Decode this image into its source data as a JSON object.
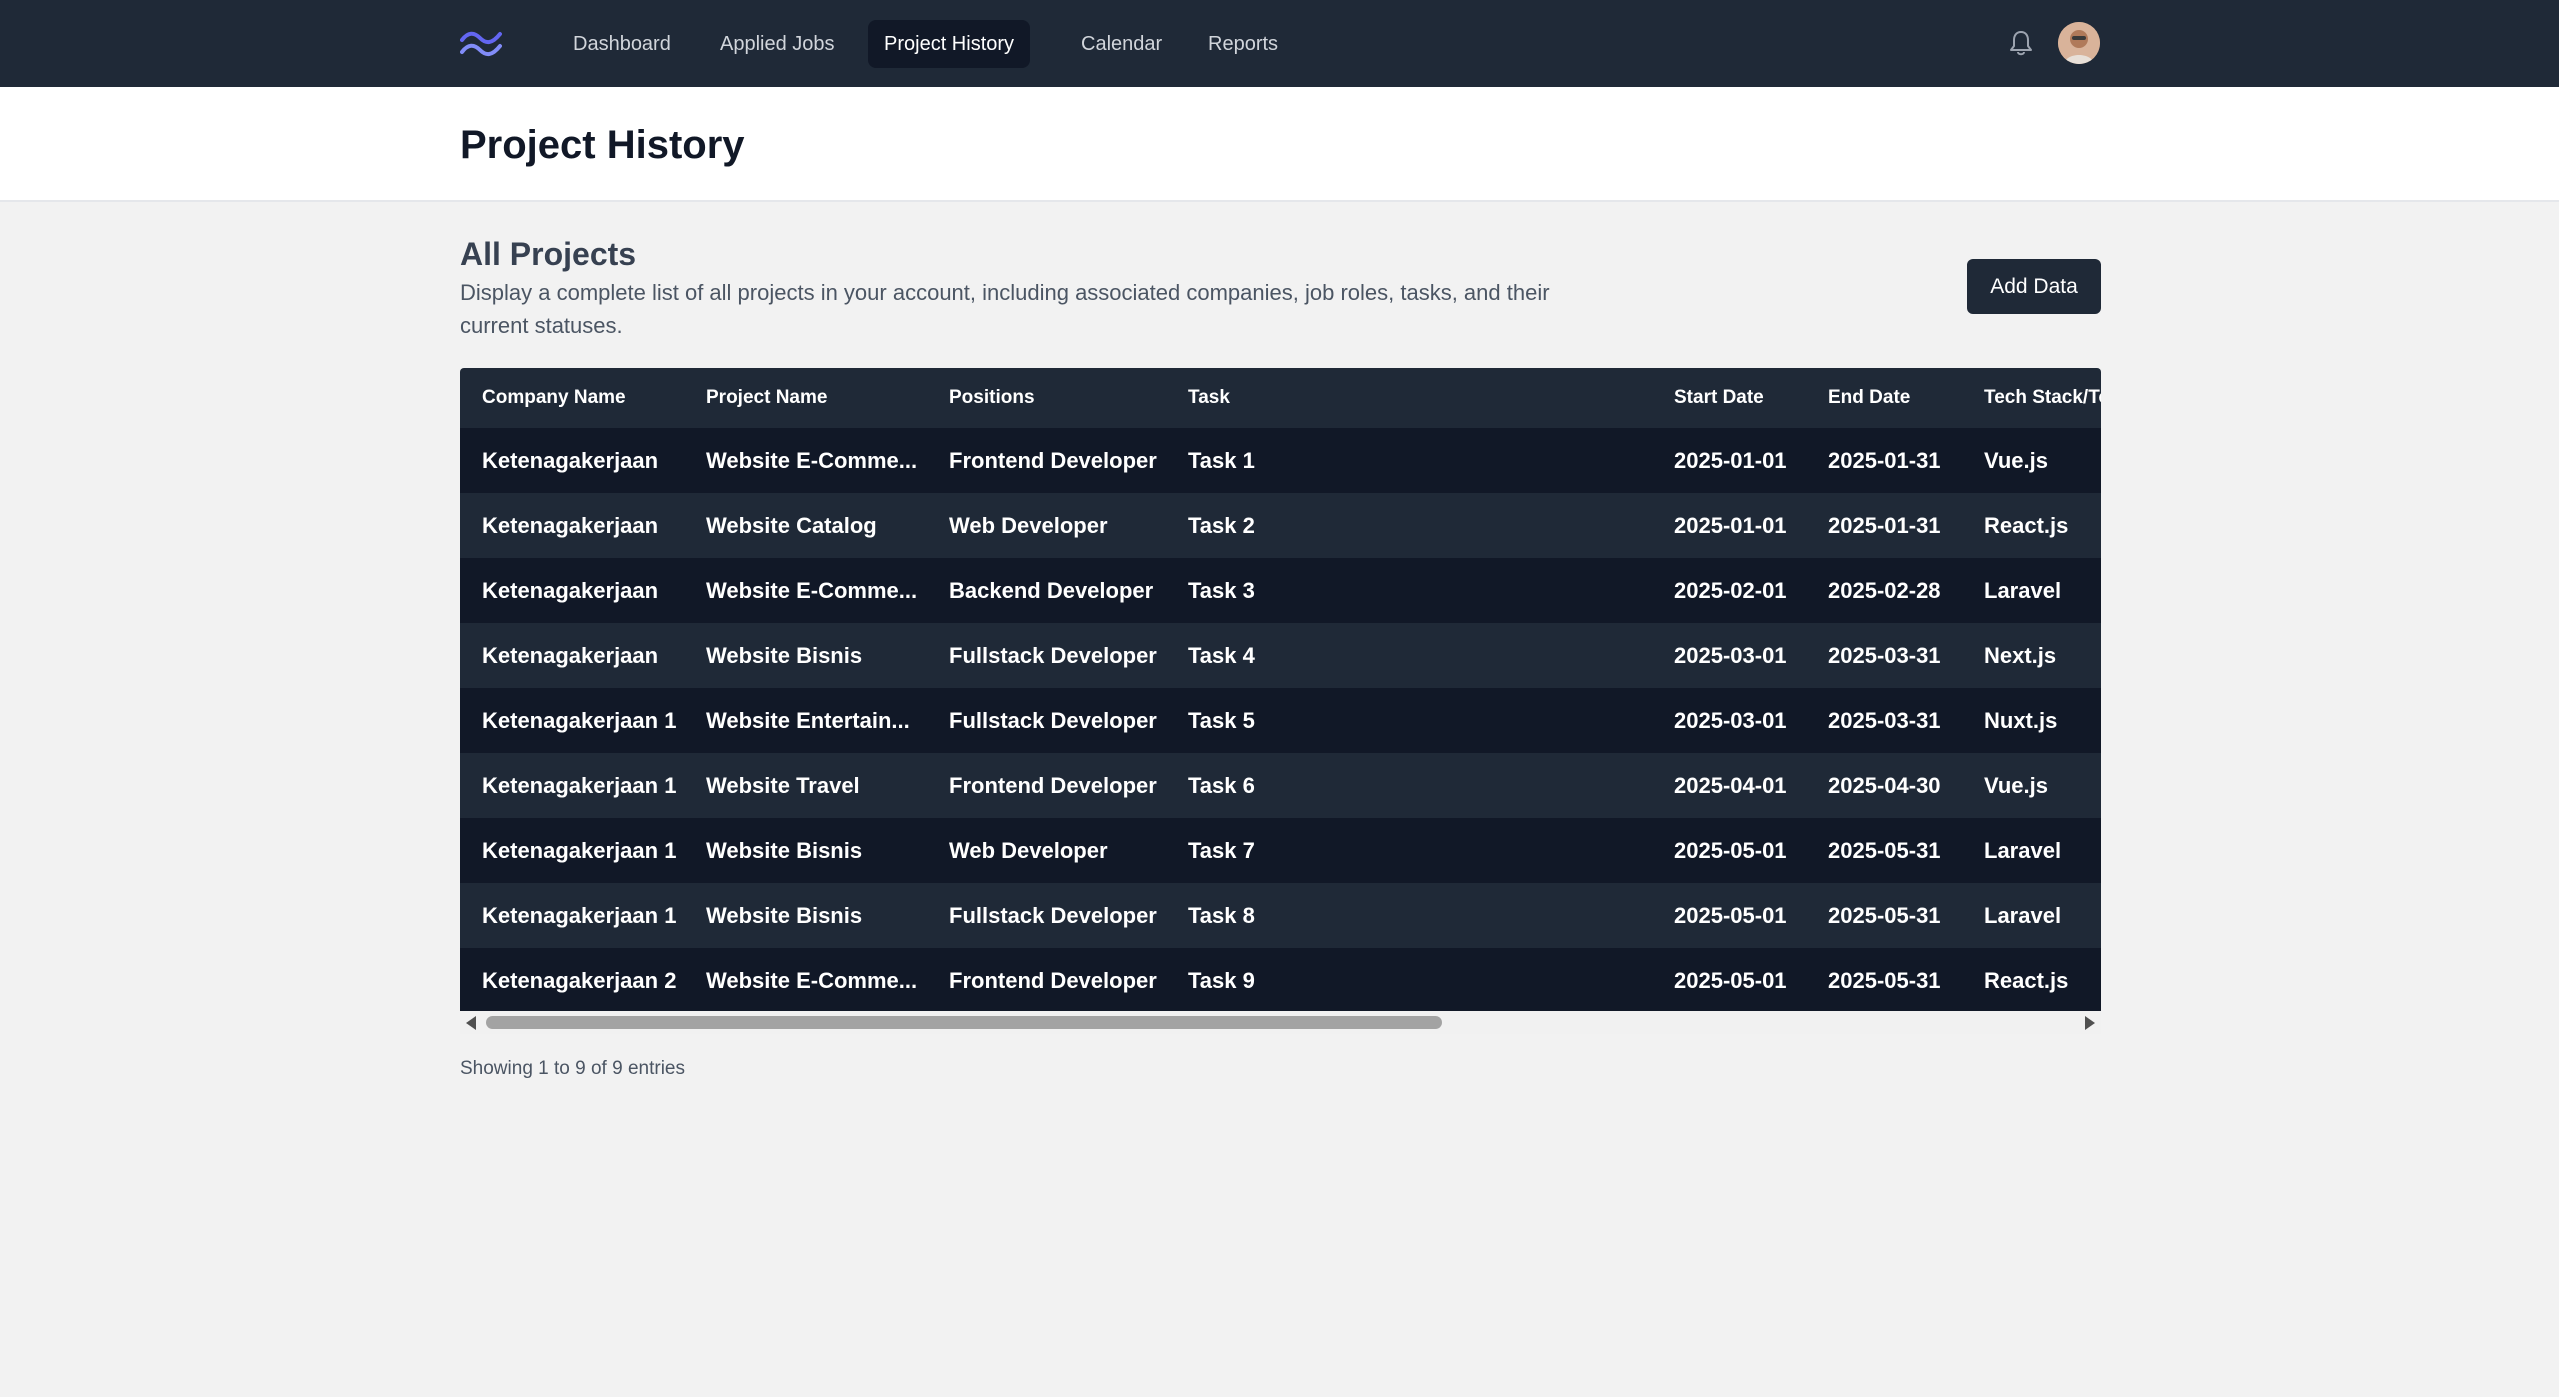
{
  "nav": {
    "logo_icon": "tailwind-wave-logo",
    "items": [
      {
        "label": "Dashboard",
        "active": false
      },
      {
        "label": "Applied Jobs",
        "active": false
      },
      {
        "label": "Project History",
        "active": true
      },
      {
        "label": "Calendar",
        "active": false
      },
      {
        "label": "Reports",
        "active": false
      }
    ],
    "notification_icon": "bell-icon",
    "avatar_icon": "user-avatar"
  },
  "page": {
    "title": "Project History"
  },
  "section": {
    "title": "All Projects",
    "description": "Display a complete list of all projects in your account, including associated companies, job roles, tasks, and their current statuses.",
    "add_button": "Add Data"
  },
  "table": {
    "columns": [
      "Company Name",
      "Project Name",
      "Positions",
      "Task",
      "Start Date",
      "End Date",
      "Tech Stack/To"
    ],
    "rows": [
      [
        "Ketenagakerjaan",
        "Website E-Comme...",
        "Frontend Developer",
        "Task 1",
        "2025-01-01",
        "2025-01-31",
        "Vue.js"
      ],
      [
        "Ketenagakerjaan",
        "Website Catalog",
        "Web Developer",
        "Task 2",
        "2025-01-01",
        "2025-01-31",
        "React.js"
      ],
      [
        "Ketenagakerjaan",
        "Website E-Comme...",
        "Backend Developer",
        "Task 3",
        "2025-02-01",
        "2025-02-28",
        "Laravel"
      ],
      [
        "Ketenagakerjaan",
        "Website Bisnis",
        "Fullstack Developer",
        "Task 4",
        "2025-03-01",
        "2025-03-31",
        "Next.js"
      ],
      [
        "Ketenagakerjaan 1",
        "Website Entertain...",
        "Fullstack Developer",
        "Task 5",
        "2025-03-01",
        "2025-03-31",
        "Nuxt.js"
      ],
      [
        "Ketenagakerjaan 1",
        "Website Travel",
        "Frontend Developer",
        "Task 6",
        "2025-04-01",
        "2025-04-30",
        "Vue.js"
      ],
      [
        "Ketenagakerjaan 1",
        "Website Bisnis",
        "Web Developer",
        "Task 7",
        "2025-05-01",
        "2025-05-31",
        "Laravel"
      ],
      [
        "Ketenagakerjaan 1",
        "Website Bisnis",
        "Fullstack Developer",
        "Task 8",
        "2025-05-01",
        "2025-05-31",
        "Laravel"
      ],
      [
        "Ketenagakerjaan 2",
        "Website E-Comme...",
        "Frontend Developer",
        "Task 9",
        "2025-05-01",
        "2025-05-31",
        "React.js"
      ]
    ]
  },
  "scrollbar": {
    "left_icon": "arrow-left-icon",
    "right_icon": "arrow-right-icon"
  },
  "footer": {
    "info": "Showing 1 to 9 of 9 entries"
  },
  "colors": {
    "nav_bg": "#1f2937",
    "row_dark": "#111827",
    "row_light": "#1f2937",
    "logo_accent": "#6366f1"
  }
}
